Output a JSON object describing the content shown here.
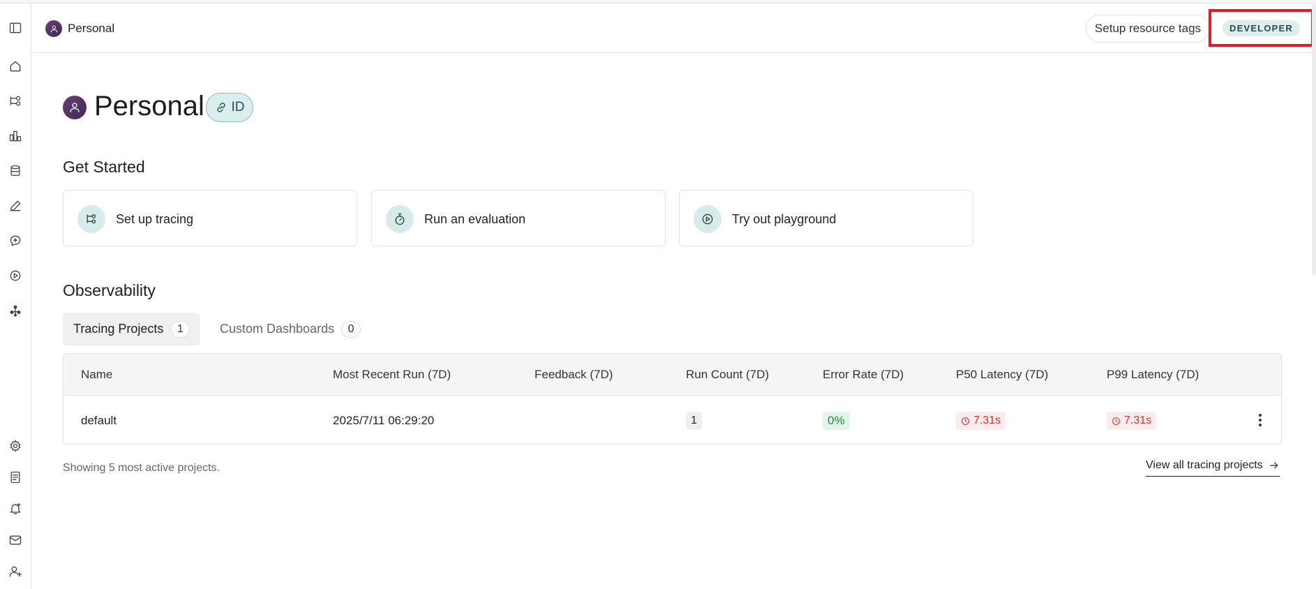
{
  "header": {
    "workspace_name": "Personal",
    "setup_tags_label": "Setup resource tags",
    "role_badge": "DEVELOPER"
  },
  "page": {
    "title": "Personal",
    "id_chip_label": "ID"
  },
  "get_started": {
    "heading": "Get Started",
    "cards": [
      {
        "label": "Set up tracing",
        "icon": "tracing-icon"
      },
      {
        "label": "Run an evaluation",
        "icon": "stopwatch-icon"
      },
      {
        "label": "Try out playground",
        "icon": "play-circle-icon"
      }
    ]
  },
  "observability": {
    "heading": "Observability",
    "tabs": [
      {
        "label": "Tracing Projects",
        "count": "1",
        "active": true
      },
      {
        "label": "Custom Dashboards",
        "count": "0",
        "active": false
      }
    ],
    "columns": [
      "Name",
      "Most Recent Run (7D)",
      "Feedback (7D)",
      "Run Count (7D)",
      "Error Rate (7D)",
      "P50 Latency (7D)",
      "P99 Latency (7D)"
    ],
    "rows": [
      {
        "name": "default",
        "most_recent_run": "2025/7/11 06:29:20",
        "feedback": "",
        "run_count": "1",
        "error_rate": "0%",
        "p50_latency": "7.31s",
        "p99_latency": "7.31s"
      }
    ],
    "footnote": "Showing 5 most active projects.",
    "view_all_label": "View all tracing projects"
  },
  "sidebar": {
    "icons": [
      "sidebar-toggle-icon",
      "home-icon",
      "tracing-icon",
      "dashboard-icon",
      "datasets-icon",
      "annotate-icon",
      "prompts-icon",
      "playground-icon",
      "deployments-icon",
      "settings-icon",
      "docs-icon",
      "notifications-icon",
      "mail-icon",
      "invite-user-icon"
    ]
  },
  "colors": {
    "accent_teal": "#d9eeed",
    "error_red": "#d3342b",
    "success_green": "#1f8a3c",
    "highlight_box": "#e01b24"
  }
}
